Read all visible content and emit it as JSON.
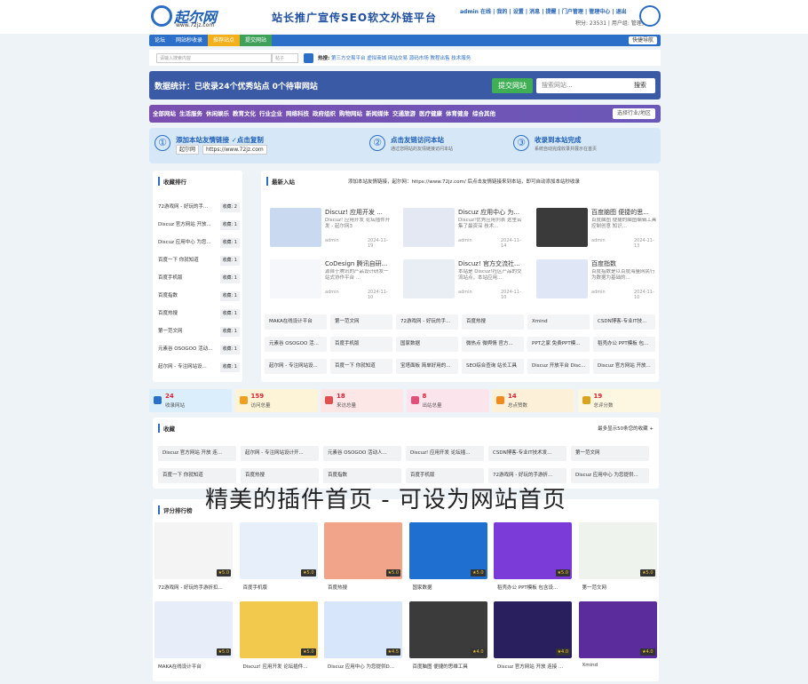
{
  "header": {
    "logo_title": "起尔网",
    "logo_url": "www.72jz.com",
    "slogan": "站长推广宣传SEO软文外链平台",
    "user_line": "admin 在线 | 我的 | 设置 | 消息 | 提醒 | 门户管理 | 管理中心 | 退出",
    "user_line2": "积分: 23531 | 用户组: 管理员"
  },
  "nav": {
    "items": [
      "论坛",
      "网站秒收录",
      "推荐站点",
      "提交网站"
    ],
    "fast": "快捷导航"
  },
  "search": {
    "placeholder": "请输入搜索内容",
    "select": "帖子",
    "hot_label": "热搜:",
    "hot": "第三方交易平台  虚拟商城  网站交易  源码市场  教程出售  技术服务"
  },
  "stats": {
    "title": "数据统计：已收录24个优秀站点 0个待审网站",
    "submit": "提交网站",
    "placeholder": "搜索网站...",
    "search": "搜索"
  },
  "categories": {
    "items": [
      "全部网站",
      "生活服务",
      "休闲娱乐",
      "教育文化",
      "行业企业",
      "网络科技",
      "政府组织",
      "购物网站",
      "新闻媒体",
      "交通旅游",
      "医疗健康",
      "体育健身",
      "综合其他"
    ],
    "industry": "选择行业/地区"
  },
  "steps": [
    {
      "num": "①",
      "title": "添加本站友情链接 ✓点击复制",
      "kw1": "起尔网",
      "kw2": "https://www.72jz.com"
    },
    {
      "num": "②",
      "title": "点击友链访问本站",
      "desc": "通过您网站的友情链接访问本站"
    },
    {
      "num": "③",
      "title": "收录到本站完成",
      "desc": "系统自动完成收录并展示在首页"
    }
  ],
  "rank": {
    "title": "收藏排行",
    "rows": [
      {
        "name": "72游戏网 - 好玩的手...",
        "count": "收藏: 2"
      },
      {
        "name": "Discuz 官方网站 开放...",
        "count": "收藏: 1"
      },
      {
        "name": "Discuz 应用中心 为您...",
        "count": "收藏: 1"
      },
      {
        "name": "百度一下 你就知道",
        "count": "收藏: 1"
      },
      {
        "name": "百度手机版",
        "count": "收藏: 1"
      },
      {
        "name": "百度指数",
        "count": "收藏: 1"
      },
      {
        "name": "百度热搜",
        "count": "收藏: 1"
      },
      {
        "name": "第一范文网",
        "count": "收藏: 1"
      },
      {
        "name": "元素谷 OSOGOO 活动...",
        "count": "收藏: 1"
      },
      {
        "name": "起尔网 - 专注网站设...",
        "count": "收藏: 1"
      }
    ]
  },
  "newest": {
    "title": "最新入站",
    "notice": "添加本站友情链接，起尔网：https://www.72jz.com/ 后点击友情链接来到本站，即可自动添加本站秒收录",
    "cards": [
      {
        "title": "Discuz! 应用开发 ...",
        "desc": "Discuz! 应用开发 论坛插件开发 - 起尔网3",
        "author": "admin",
        "date": "2024-11-19"
      },
      {
        "title": "Discuz 应用中心 为...",
        "desc": "Discuz!优秀应用列表 这里云集了最资深 技术...",
        "author": "admin",
        "date": "2024-11-14"
      },
      {
        "title": "百度脑图 便捷的思...",
        "desc": "百度脑图 便捷的脑图编辑工具 控制创意 知识...",
        "author": "admin",
        "date": "2024-11-13"
      },
      {
        "title": "CoDesign 腾讯自研...",
        "desc": "源自于腾讯的产品设计研发一站式协作平台 ...",
        "author": "admin",
        "date": "2024-11-10"
      },
      {
        "title": "Discuz! 官方交流社...",
        "desc": "本站是 Discuz!社区产品的交流站点，本站应用...",
        "author": "admin",
        "date": "2024-11-10"
      },
      {
        "title": "百度指数",
        "desc": "百度指数是以百度海量网民行为数据为基础的...",
        "author": "admin",
        "date": "2024-11-10"
      }
    ],
    "tags": [
      "MAKA在线设计平台",
      "第一范文网",
      "72游戏网 - 好玩的手...",
      "百度热搜",
      "Xmind",
      "CSDN博客-专业IT技...",
      "元素谷 OSOGOO 活...",
      "百度手机版",
      "国家数据",
      "微热点 微舆情 官方...",
      "PPT之家 免费PPT模...",
      "稻壳办公 PPT模板 包...",
      "起尔网 - 专注网站设...",
      "百度一下 你就知道",
      "宝塔面板 简单好用的...",
      "SEO综合查询 站长工具",
      "Discuz 开放平台 Disc...",
      "Discuz 官方网站 开放..."
    ]
  },
  "kpis": [
    {
      "value": "24",
      "label": "收录网站"
    },
    {
      "value": "159",
      "label": "访问总量"
    },
    {
      "value": "18",
      "label": "来访总量"
    },
    {
      "value": "8",
      "label": "出站总量"
    },
    {
      "value": "14",
      "label": "总点赞数"
    },
    {
      "value": "19",
      "label": "总评分数"
    }
  ],
  "fav": {
    "title": "收藏",
    "right": "最多显示50条您的收藏  +",
    "tags": [
      "Discuz 官方网站 开放 连...",
      "起尔网 - 专注网站设计开...",
      "元素谷 OSOGOO 活动人...",
      "Discuz! 应用开发 论坛插...",
      "CSDN博客-专业IT技术发...",
      "第一范文网",
      "百度一下 你就知道",
      "百度热搜",
      "百度指数",
      "百度手机版",
      "72游戏网 - 好玩的手游折...",
      "Discuz 应用中心 为您提供..."
    ]
  },
  "banner": "精美的插件首页 - 可设为网站首页",
  "score": {
    "title": "评分排行榜",
    "tiles": [
      {
        "name": "72游戏网 - 好玩的手游折扣...",
        "star": "★5.0"
      },
      {
        "name": "百度手机版",
        "star": "★5.0"
      },
      {
        "name": "百度热搜",
        "star": "★5.0"
      },
      {
        "name": "国家数据",
        "star": "★5.0"
      },
      {
        "name": "稻壳办公 PPT模板 包含设...",
        "star": "★5.0"
      },
      {
        "name": "第一范文网",
        "star": "★5.0"
      },
      {
        "name": "MAKA在线设计平台",
        "star": "★5.0"
      },
      {
        "name": "Discuz! 应用开发 论坛插件...",
        "star": "★5.0"
      },
      {
        "name": "Discuz 应用中心 为您提供D...",
        "star": "★4.5"
      },
      {
        "name": "百度脑图 便捷的思维工具",
        "star": "★4.0"
      },
      {
        "name": "Discuz 官方网站 开放 连接 ...",
        "star": "★4.0"
      },
      {
        "name": "Xmind",
        "star": "★4.0"
      }
    ]
  }
}
